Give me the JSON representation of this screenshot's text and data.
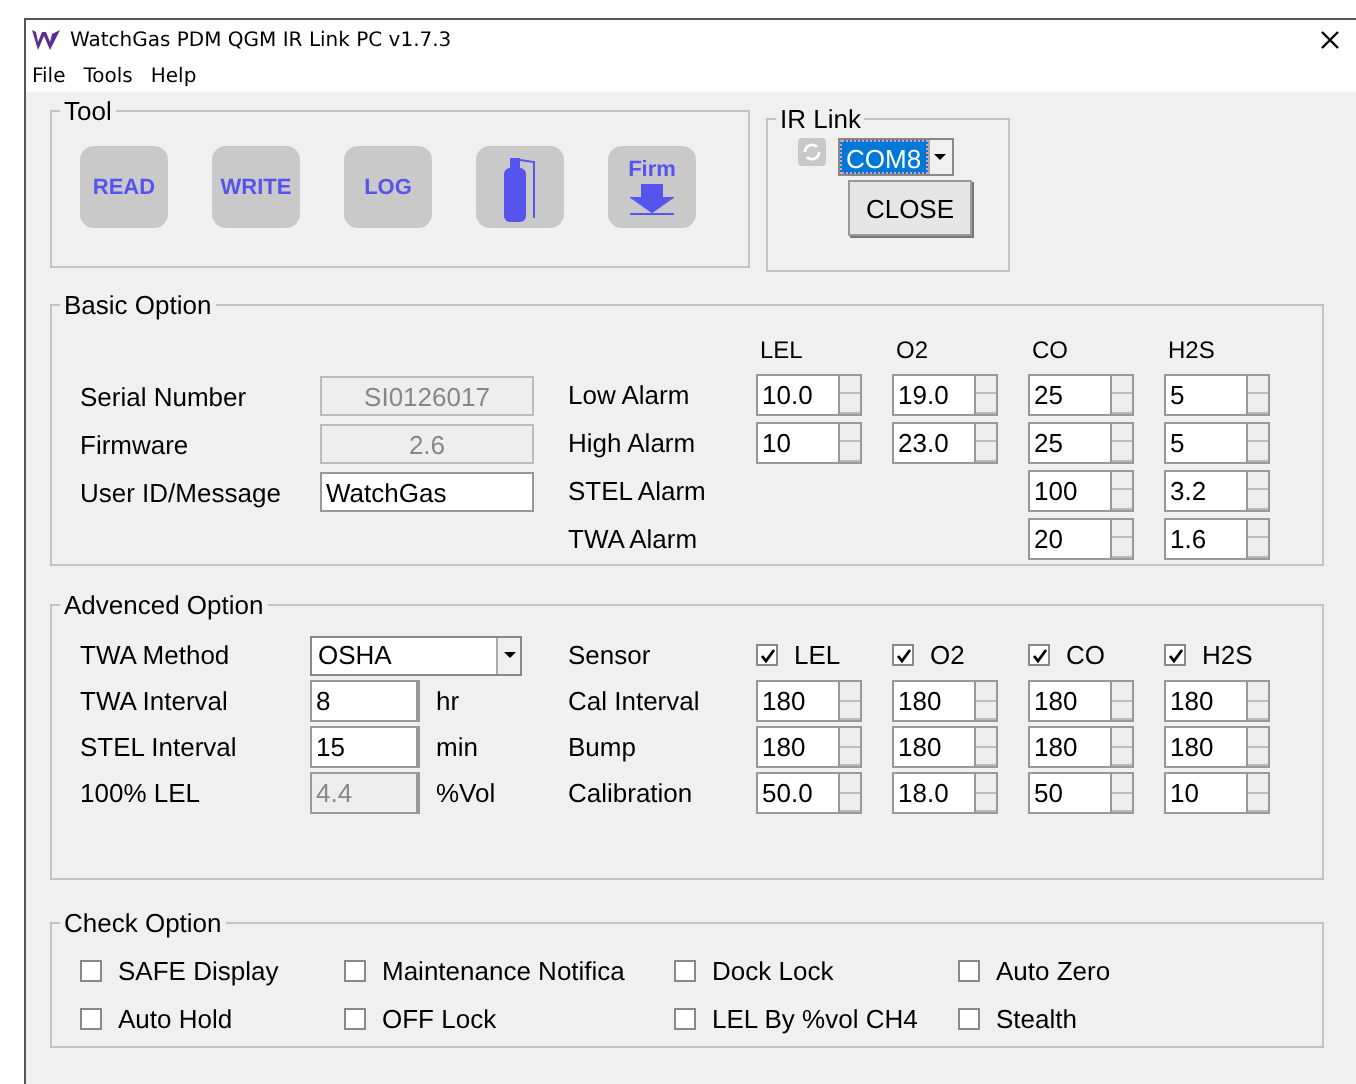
{
  "window": {
    "title": "WatchGas PDM QGM IR Link PC v1.7.3"
  },
  "menu": [
    "File",
    "Tools",
    "Help"
  ],
  "tool": {
    "title": "Tool",
    "buttons": [
      {
        "kind": "text",
        "label": "READ"
      },
      {
        "kind": "text",
        "label": "WRITE"
      },
      {
        "kind": "text",
        "label": "LOG"
      },
      {
        "kind": "cylinder"
      },
      {
        "kind": "firmware",
        "label": "Firm"
      }
    ]
  },
  "ir_link": {
    "title": "IR Link",
    "port": "COM8",
    "port_selected": true,
    "button": "CLOSE"
  },
  "basic_option": {
    "title": "Basic Option",
    "fields": [
      {
        "label": "Serial Number",
        "value": "SI0126017",
        "disabled": true
      },
      {
        "label": "Firmware",
        "value": "2.6",
        "disabled": true
      },
      {
        "label": "User ID/Message",
        "value": "WatchGas",
        "disabled": false
      }
    ],
    "gas_headers": [
      "LEL",
      "O2",
      "CO",
      "H2S"
    ],
    "alarms": [
      {
        "kind": "all_gases",
        "label": "Low Alarm",
        "values": [
          "10.0",
          "19.0",
          "25",
          "5"
        ]
      },
      {
        "kind": "all_gases",
        "label": "High Alarm",
        "values": [
          "10",
          "23.0",
          "25",
          "5"
        ]
      },
      {
        "kind": "toxic_only",
        "label": "STEL Alarm",
        "values": [
          "100",
          "3.2"
        ]
      },
      {
        "kind": "toxic_only",
        "label": "TWA Alarm",
        "values": [
          "20",
          "1.6"
        ]
      }
    ]
  },
  "advanced_option": {
    "title": "Advenced Option",
    "fields": [
      {
        "kind": "dropdown",
        "label": "TWA Method",
        "value": "OSHA"
      },
      {
        "kind": "spin",
        "label": "TWA Interval",
        "value": "8",
        "unit": "hr",
        "disabled": false
      },
      {
        "kind": "spin",
        "label": "STEL Interval",
        "value": "15",
        "unit": "min",
        "disabled": false
      },
      {
        "kind": "spin",
        "label": "100% LEL",
        "value": "4.4",
        "unit": "%Vol",
        "disabled": true
      }
    ],
    "sensor_label": "Sensor",
    "sensors": [
      {
        "label": "LEL",
        "checked": true
      },
      {
        "label": "O2",
        "checked": true
      },
      {
        "label": "CO",
        "checked": true
      },
      {
        "label": "H2S",
        "checked": true
      }
    ],
    "rows": [
      {
        "label": "Cal Interval",
        "values": [
          "180",
          "180",
          "180",
          "180"
        ]
      },
      {
        "label": "Bump",
        "values": [
          "180",
          "180",
          "180",
          "180"
        ]
      },
      {
        "label": "Calibration",
        "values": [
          "50.0",
          "18.0",
          "50",
          "10"
        ]
      }
    ]
  },
  "check_option": {
    "title": "Check Option",
    "items": [
      {
        "label": "SAFE Display",
        "checked": false
      },
      {
        "label": "Maintenance Notifica",
        "checked": false
      },
      {
        "label": "Dock Lock",
        "checked": false
      },
      {
        "label": "Auto Zero",
        "checked": false
      },
      {
        "label": "Auto Hold",
        "checked": false
      },
      {
        "label": "OFF Lock",
        "checked": false
      },
      {
        "label": "LEL By %vol CH4",
        "checked": false
      },
      {
        "label": "Stealth",
        "checked": false
      }
    ]
  }
}
